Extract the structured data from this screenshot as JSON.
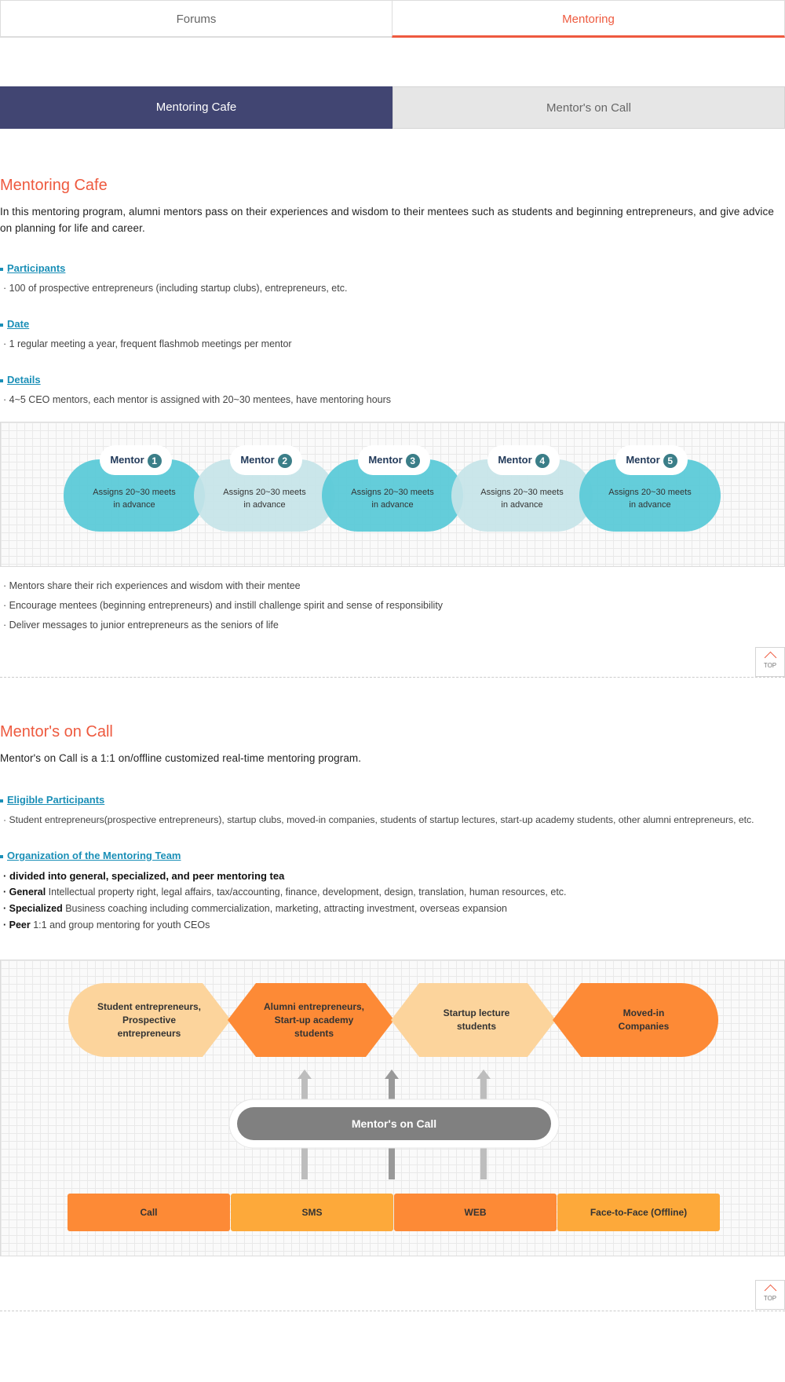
{
  "tabs": {
    "forums": "Forums",
    "mentoring": "Mentoring"
  },
  "subtabs": {
    "cafe": "Mentoring Cafe",
    "call": "Mentor's on Call"
  },
  "cafe": {
    "title": "Mentoring Cafe",
    "intro": "In this mentoring program, alumni mentors pass on their experiences and wisdom to their mentees such as students and beginning entrepreneurs, and give advice on planning for life and career.",
    "participants_label": "Participants",
    "participants_text": "· 100 of prospective entrepreneurs (including startup clubs), entrepreneurs, etc.",
    "date_label": "Date",
    "date_text": "· 1 regular meeting a year, frequent flashmob meetings per mentor",
    "details_label": "Details",
    "details_text": "· 4~5 CEO mentors, each mentor is assigned with 20~30 mentees, have mentoring hours",
    "mentor_word": "Mentor",
    "mentors": [
      {
        "num": "1",
        "line1": "Assigns 20~30 meets",
        "line2": "in advance"
      },
      {
        "num": "2",
        "line1": "Assigns 20~30 meets",
        "line2": "in advance"
      },
      {
        "num": "3",
        "line1": "Assigns 20~30 meets",
        "line2": "in advance"
      },
      {
        "num": "4",
        "line1": "Assigns 20~30 meets",
        "line2": "in advance"
      },
      {
        "num": "5",
        "line1": "Assigns 20~30 meets",
        "line2": "in advance"
      }
    ],
    "bullets": [
      "· Mentors share their rich experiences and wisdom with their mentee",
      "· Encourage mentees (beginning entrepreneurs) and instill challenge spirit and sense of responsibility",
      "· Deliver messages to junior entrepreneurs as the seniors of life"
    ]
  },
  "top_label": "TOP",
  "call": {
    "title": "Mentor's on Call",
    "intro": "Mentor's on Call is a 1:1 on/offline customized real-time mentoring program.",
    "eligible_label": "Eligible Participants",
    "eligible_text": "· Student entrepreneurs(prospective entrepreneurs), startup clubs, moved-in companies, students of startup lectures, start-up academy students, other alumni entrepreneurs, etc.",
    "org_label": "Organization of the Mentoring Team",
    "org_lines": [
      {
        "bold": "· divided into general, specialized, and peer mentoring tea",
        "text": ""
      },
      {
        "bold": "· General",
        "text": " Intellectual property right, legal affairs, tax/accounting, finance, development, design, translation, human resources, etc."
      },
      {
        "bold": "· Specialized",
        "text": " Business coaching including commercialization, marketing, attracting investment, overseas expansion"
      },
      {
        "bold": "· Peer",
        "text": " 1:1 and group mentoring for youth CEOs"
      }
    ],
    "groups": [
      {
        "l1": "Student entrepreneurs,",
        "l2": "Prospective",
        "l3": "entrepreneurs"
      },
      {
        "l1": "Alumni entrepreneurs,",
        "l2": "Start-up academy",
        "l3": "students"
      },
      {
        "l1": "Startup lecture",
        "l2": "students",
        "l3": ""
      },
      {
        "l1": "Moved-in",
        "l2": "Companies",
        "l3": ""
      }
    ],
    "center_label": "Mentor's on Call",
    "channels": [
      "Call",
      "SMS",
      "WEB",
      "Face-to-Face (Offline)"
    ],
    "colors": {
      "orange": "#fd8a36",
      "light_orange": "#fcd49c",
      "yellow": "#fda93a",
      "gray": "#808080"
    }
  }
}
